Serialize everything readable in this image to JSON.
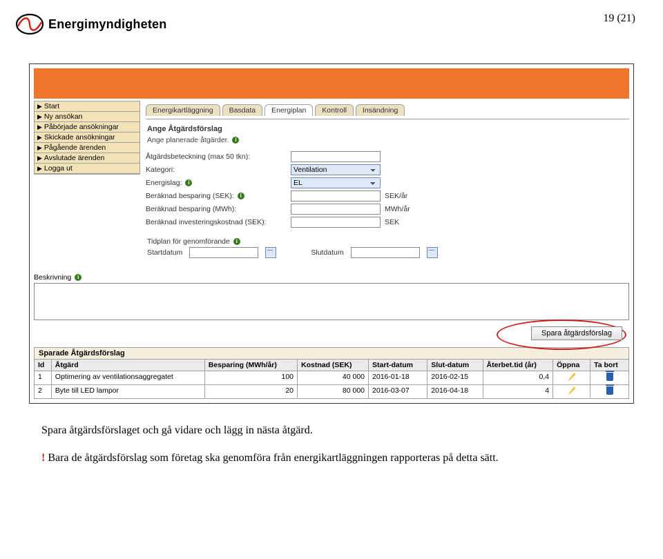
{
  "header": {
    "logo_text": "Energimyndigheten",
    "page_number": "19 (21)"
  },
  "sidebar": {
    "items": [
      {
        "label": "Start"
      },
      {
        "label": "Ny ansökan"
      },
      {
        "label": "Påbörjade ansökningar"
      },
      {
        "label": "Skickade ansökningar"
      },
      {
        "label": "Pågående ärenden"
      },
      {
        "label": "Avslutade ärenden"
      },
      {
        "label": "Logga ut"
      }
    ]
  },
  "tabs": [
    {
      "label": "Energikartläggning"
    },
    {
      "label": "Basdata"
    },
    {
      "label": "Energiplan"
    },
    {
      "label": "Kontroll"
    },
    {
      "label": "Insändning"
    }
  ],
  "form": {
    "section_title": "Ange Åtgärdsförslag",
    "hint": "Ange planerade åtgärder.",
    "label_beteckning": "Åtgärdsbeteckning (max 50 tkn):",
    "label_kategori": "Kategori:",
    "value_kategori": "Ventilation",
    "label_energislag": "Energislag:",
    "value_energislag": "EL",
    "label_besp_sek": "Beräknad besparing (SEK):",
    "unit_sek_ar": "SEK/år",
    "label_besp_mwh": "Beräknad besparing (MWh):",
    "unit_mwh_ar": "MWh/år",
    "label_inv": "Beräknad investeringskostnad (SEK):",
    "unit_sek": "SEK",
    "label_tidplan": "Tidplan för genomförande",
    "label_start": "Startdatum",
    "label_slut": "Slutdatum",
    "label_beskrivning": "Beskrivning",
    "save_button": "Spara åtgärdsförslag"
  },
  "saved": {
    "title": "Sparade Åtgärdsförslag",
    "cols": {
      "id": "Id",
      "atgard": "Åtgärd",
      "besparing": "Besparing (MWh/år)",
      "kostnad": "Kostnad (SEK)",
      "start": "Start-datum",
      "slut": "Slut-datum",
      "aterbet": "Återbet.tid (år)",
      "oppna": "Öppna",
      "tabort": "Ta bort"
    },
    "rows": [
      {
        "id": "1",
        "atgard": "Optimering av ventilationsaggregatet",
        "besparing": "100",
        "kostnad": "40 000",
        "start": "2016-01-18",
        "slut": "2016-02-15",
        "aterbet": "0,4"
      },
      {
        "id": "2",
        "atgard": "Byte till LED lampor",
        "besparing": "20",
        "kostnad": "80 000",
        "start": "2016-03-07",
        "slut": "2016-04-18",
        "aterbet": "4"
      }
    ]
  },
  "body": {
    "p1": "Spara åtgärdsförslaget och gå vidare och lägg in nästa åtgärd.",
    "p2": " Bara de åtgärdsförslag som företag ska genomföra från energikartläggningen rapporteras på detta sätt."
  }
}
